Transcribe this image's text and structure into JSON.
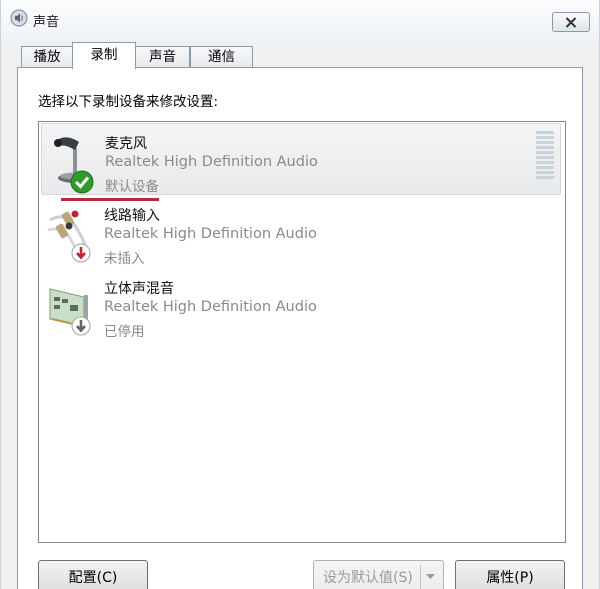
{
  "window": {
    "title": "声音"
  },
  "tabs": [
    {
      "label": "播放",
      "active": false
    },
    {
      "label": "录制",
      "active": true
    },
    {
      "label": "声音",
      "active": false
    },
    {
      "label": "通信",
      "active": false
    }
  ],
  "instruction": "选择以下录制设备来修改设置:",
  "devices": [
    {
      "name": "麦克风",
      "driver": "Realtek High Definition Audio",
      "status": "默认设备",
      "icon": "microphone-icon",
      "badge": "check-icon",
      "selected": true
    },
    {
      "name": "线路输入",
      "driver": "Realtek High Definition Audio",
      "status": "未插入",
      "icon": "line-in-icon",
      "badge": "red-down-arrow-icon",
      "selected": false
    },
    {
      "name": "立体声混音",
      "driver": "Realtek High Definition Audio",
      "status": "已停用",
      "icon": "sound-card-icon",
      "badge": "gray-down-arrow-icon",
      "selected": false
    }
  ],
  "buttons": {
    "configure": "配置(C)",
    "set_default": "设为默认值(S)",
    "properties": "属性(P)"
  },
  "colors": {
    "selection_underline": "#b52b3c",
    "check_badge": "#2f9b2c",
    "unplugged_badge": "#c0262f",
    "disabled_badge": "#606468"
  }
}
